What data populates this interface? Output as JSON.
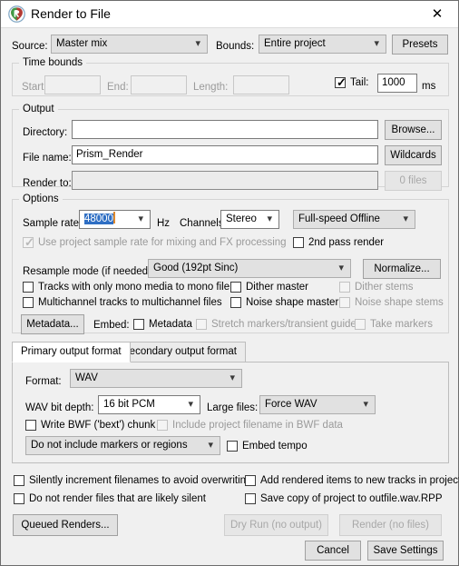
{
  "window": {
    "title": "Render to File",
    "icon": "reaper-logo-icon",
    "close_label": "✕"
  },
  "top": {
    "source_label": "Source:",
    "source_value": "Master mix",
    "bounds_label": "Bounds:",
    "bounds_value": "Entire project",
    "presets_label": "Presets"
  },
  "time_bounds": {
    "group_title": "Time bounds",
    "start_label": "Start:",
    "start_value": "",
    "end_label": "End:",
    "end_value": "",
    "length_label": "Length:",
    "length_value": "",
    "tail_label": "Tail:",
    "tail_checked": true,
    "tail_value": "1000",
    "tail_units": "ms"
  },
  "output": {
    "group_title": "Output",
    "directory_label": "Directory:",
    "directory_value": "",
    "browse_label": "Browse...",
    "filename_label": "File name:",
    "filename_value": "Prism_Render",
    "wildcards_label": "Wildcards",
    "renderto_label": "Render to:",
    "renderto_value": "",
    "files_count_label": "0 files"
  },
  "options": {
    "group_title": "Options",
    "sample_rate_label": "Sample rate:",
    "sample_rate_value": "48000",
    "hz_label": "Hz",
    "channels_label": "Channels:",
    "channels_value": "Stereo",
    "speed_value": "Full-speed Offline",
    "use_project_sr_label": "Use project sample rate for mixing and FX processing",
    "use_project_sr_checked": true,
    "second_pass_label": "2nd pass render",
    "second_pass_checked": false,
    "resample_label": "Resample mode (if needed):",
    "resample_value": "Good (192pt Sinc)",
    "normalize_label": "Normalize...",
    "mono_tracks_label": "Tracks with only mono media to mono file",
    "mono_tracks_checked": false,
    "multichannel_label": "Multichannel tracks to multichannel files",
    "multichannel_checked": false,
    "dither_master_label": "Dither master",
    "dither_master_checked": false,
    "noise_shape_master_label": "Noise shape master",
    "noise_shape_master_checked": false,
    "dither_stems_label": "Dither stems",
    "dither_stems_checked": false,
    "noise_shape_stems_label": "Noise shape stems",
    "noise_shape_stems_checked": false,
    "metadata_button_label": "Metadata...",
    "embed_label": "Embed:",
    "embed_metadata_label": "Metadata",
    "embed_metadata_checked": false,
    "stretch_markers_label": "Stretch markers/transient guides",
    "stretch_markers_checked": false,
    "take_markers_label": "Take markers",
    "take_markers_checked": false
  },
  "format_tabs": {
    "primary_label": "Primary output format",
    "secondary_label": "Secondary output format",
    "active": "primary"
  },
  "format_panel": {
    "format_label": "Format:",
    "format_value": "WAV",
    "bitdepth_label": "WAV bit depth:",
    "bitdepth_value": "16 bit PCM",
    "largefiles_label": "Large files:",
    "largefiles_value": "Force WAV",
    "bwf_label": "Write BWF ('bext') chunk",
    "bwf_checked": false,
    "include_project_filename_label": "Include project filename in BWF data",
    "include_project_filename_checked": false,
    "markers_value": "Do not include markers or regions",
    "embed_tempo_label": "Embed tempo",
    "embed_tempo_checked": false
  },
  "bottom": {
    "silently_increment_label": "Silently increment filenames to avoid overwriting",
    "silently_increment_checked": false,
    "do_not_render_silent_label": "Do not render files that are likely silent",
    "do_not_render_silent_checked": false,
    "add_rendered_items_label": "Add rendered items to new tracks in project",
    "add_rendered_items_checked": false,
    "save_copy_label": "Save copy of project to outfile.wav.RPP",
    "save_copy_checked": false,
    "queued_renders_label": "Queued Renders...",
    "dry_run_label": "Dry Run (no output)",
    "render_label": "Render (no files)",
    "cancel_label": "Cancel",
    "save_settings_label": "Save Settings"
  },
  "colors": {
    "dialog_bg": "#f0f0f0",
    "titlebar_bg": "#ffffff",
    "selection_blue": "#2f6fc4",
    "caret_orange": "#e08a2e",
    "disabled_text": "#9a9a9a"
  }
}
